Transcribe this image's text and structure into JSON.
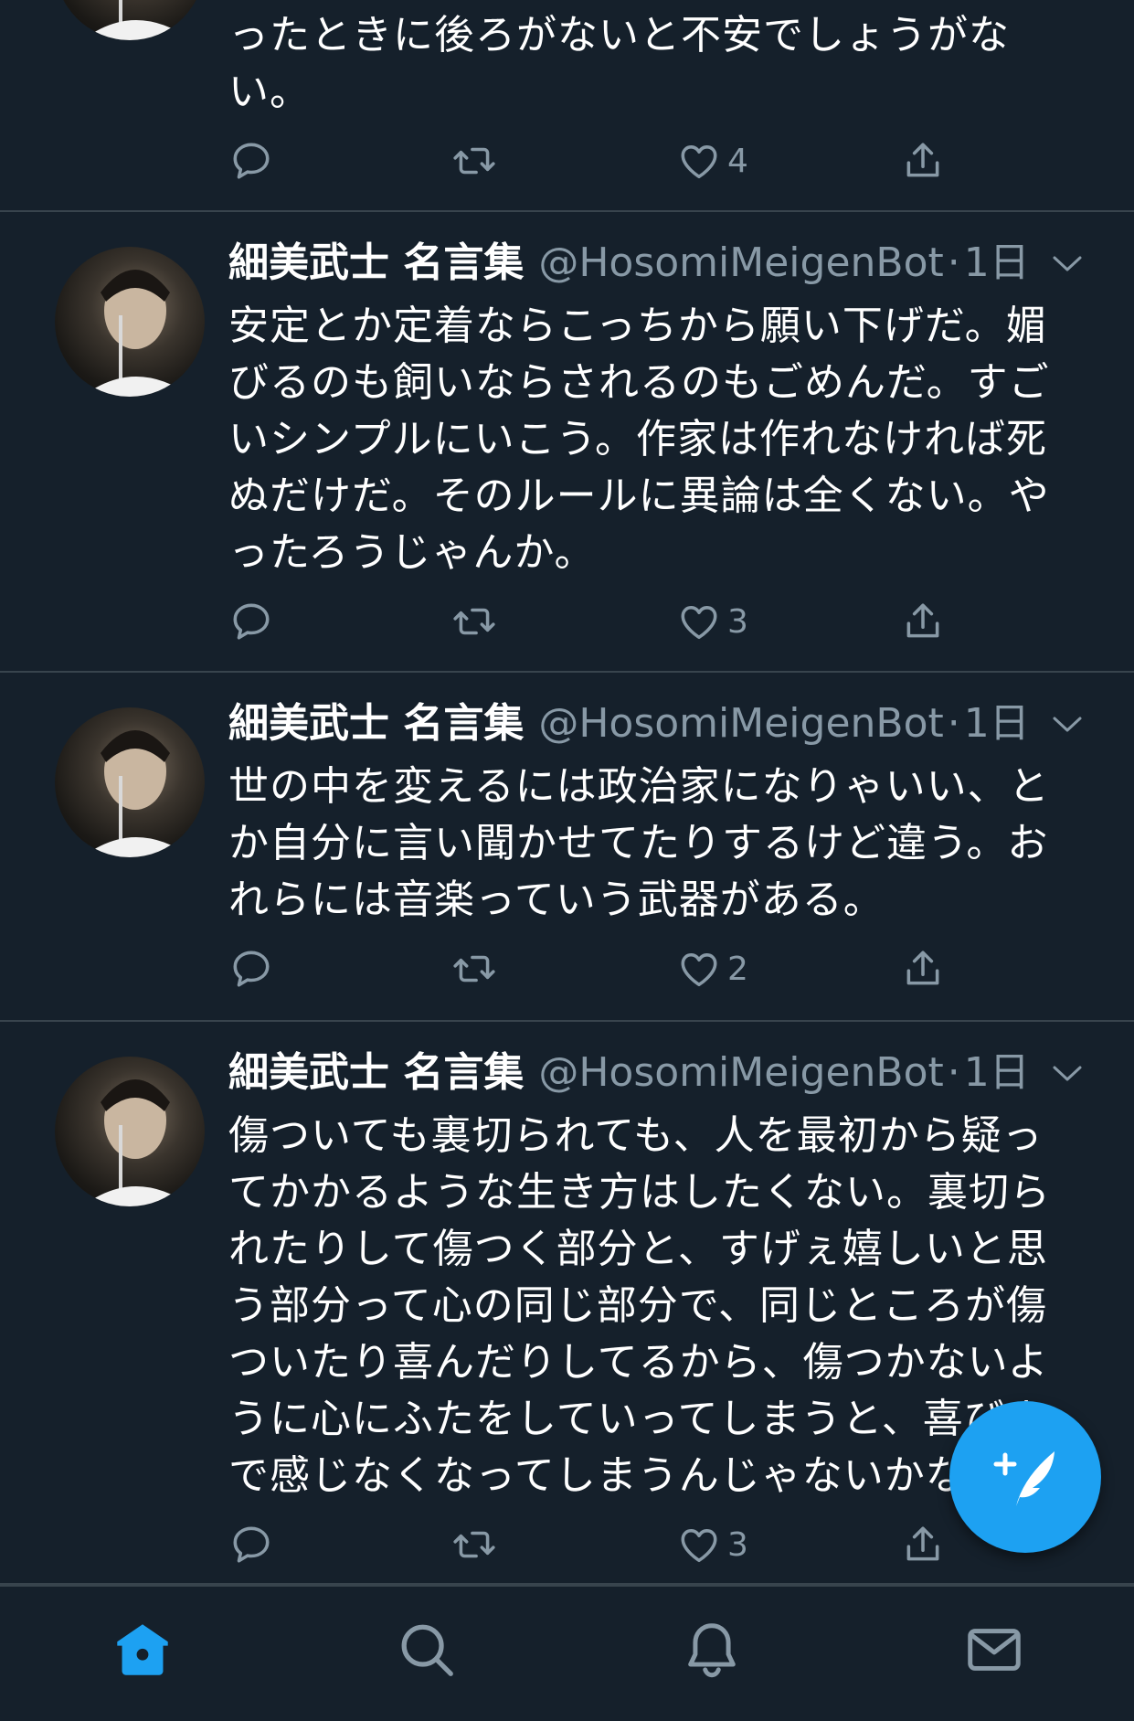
{
  "tweets": [
    {
      "lines": [
        "ったときに後ろがないと不安でしょうがな",
        "い。"
      ],
      "reply_count": "",
      "retweet_count": "",
      "like_count": "4"
    },
    {
      "name": "細美武士 名言集",
      "handle": "@HosomiMeigenBot",
      "separator": "·",
      "time": "1日",
      "lines": [
        "安定とか定着ならこっちから願い下げだ。媚",
        "びるのも飼いならされるのもごめんだ。すご",
        "いシンプルにいこう。作家は作れなければ死",
        "ぬだけだ。そのルールに異論は全くない。や",
        "ったろうじゃんか。"
      ],
      "like_count": "3"
    },
    {
      "name": "細美武士 名言集",
      "handle": "@HosomiMeigenBot",
      "separator": "·",
      "time": "1日",
      "lines": [
        "世の中を変えるには政治家になりゃいい、と",
        "か自分に言い聞かせてたりするけど違う。お",
        "れらには音楽っていう武器がある。"
      ],
      "like_count": "2"
    },
    {
      "name": "細美武士 名言集",
      "handle": "@HosomiMeigenBot",
      "separator": "·",
      "time": "1日",
      "lines": [
        "傷ついても裏切られても、人を最初から疑っ",
        "てかかるような生き方はしたくない。裏切ら",
        "れたりして傷つく部分と、すげぇ嬉しいと思",
        "う部分って心の同じ部分で、同じところが傷",
        "ついたり喜んだりしてるから、傷つかないよ",
        "うに心にふたをしていってしまうと、喜びま",
        "で感じなくなってしまうんじゃないかな。"
      ],
      "like_count": "3"
    }
  ],
  "colors": {
    "background": "#15202b",
    "divider": "#38444d",
    "secondary_text": "#8899a6",
    "accent": "#1da1f2"
  },
  "icons": {
    "actions": [
      "reply-icon",
      "retweet-icon",
      "like-icon",
      "share-icon"
    ],
    "tabs": [
      "home-icon",
      "search-icon",
      "notifications-icon",
      "messages-icon"
    ],
    "fab": "compose-tweet-icon"
  }
}
